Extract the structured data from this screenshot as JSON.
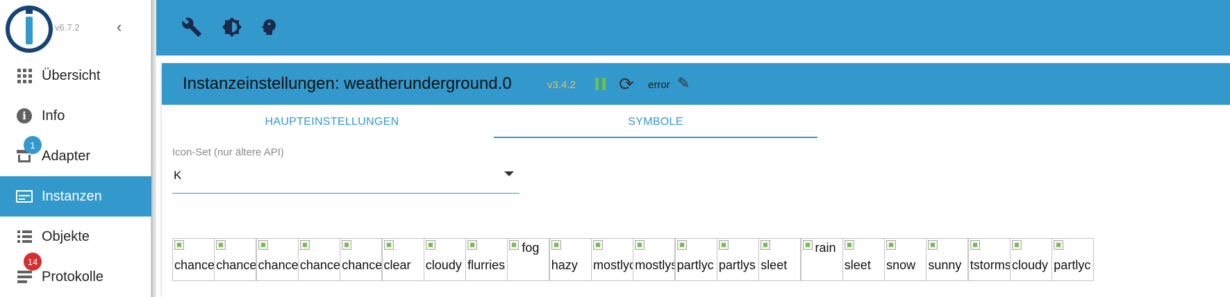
{
  "app": {
    "version": "v6.7.2",
    "colors": {
      "primary": "#3399cc",
      "logo_dark": "#164477",
      "badge_red": "#d32f2f",
      "status_green": "#6fbf4a",
      "version_amber": "#e0c05a"
    }
  },
  "sidebar": {
    "items": [
      {
        "label": "Übersicht",
        "icon": "grid-icon"
      },
      {
        "label": "Info",
        "icon": "info-icon"
      },
      {
        "label": "Adapter",
        "icon": "store-icon",
        "badge": "1"
      },
      {
        "label": "Instanzen",
        "icon": "instances-icon",
        "active": true
      },
      {
        "label": "Objekte",
        "icon": "list-icon"
      },
      {
        "label": "Protokolle",
        "icon": "log-icon",
        "badge": "14"
      }
    ]
  },
  "toolbar": {
    "icons": [
      "wrench-icon",
      "brightness-icon",
      "expert-mode-icon"
    ]
  },
  "instance": {
    "title": "Instanzeinstellungen: weatherunderground.0",
    "version": "v3.4.2",
    "status": "error",
    "tabs": [
      {
        "label": "HAUPTEINSTELLUNGEN",
        "active": false
      },
      {
        "label": "SYMBOLE",
        "active": true
      }
    ],
    "iconset": {
      "label": "Icon-Set (nur ältere API)",
      "value": "K"
    },
    "symbols": [
      "chance",
      "chance",
      "chance",
      "chance",
      "chance",
      "clear",
      "cloudy",
      "flurries",
      "fog",
      "hazy",
      "mostlyc",
      "mostlys",
      "partlyc",
      "partlys",
      "sleet",
      "rain",
      "sleet",
      "snow",
      "sunny",
      "tstorms",
      "cloudy",
      "partlyc"
    ]
  }
}
